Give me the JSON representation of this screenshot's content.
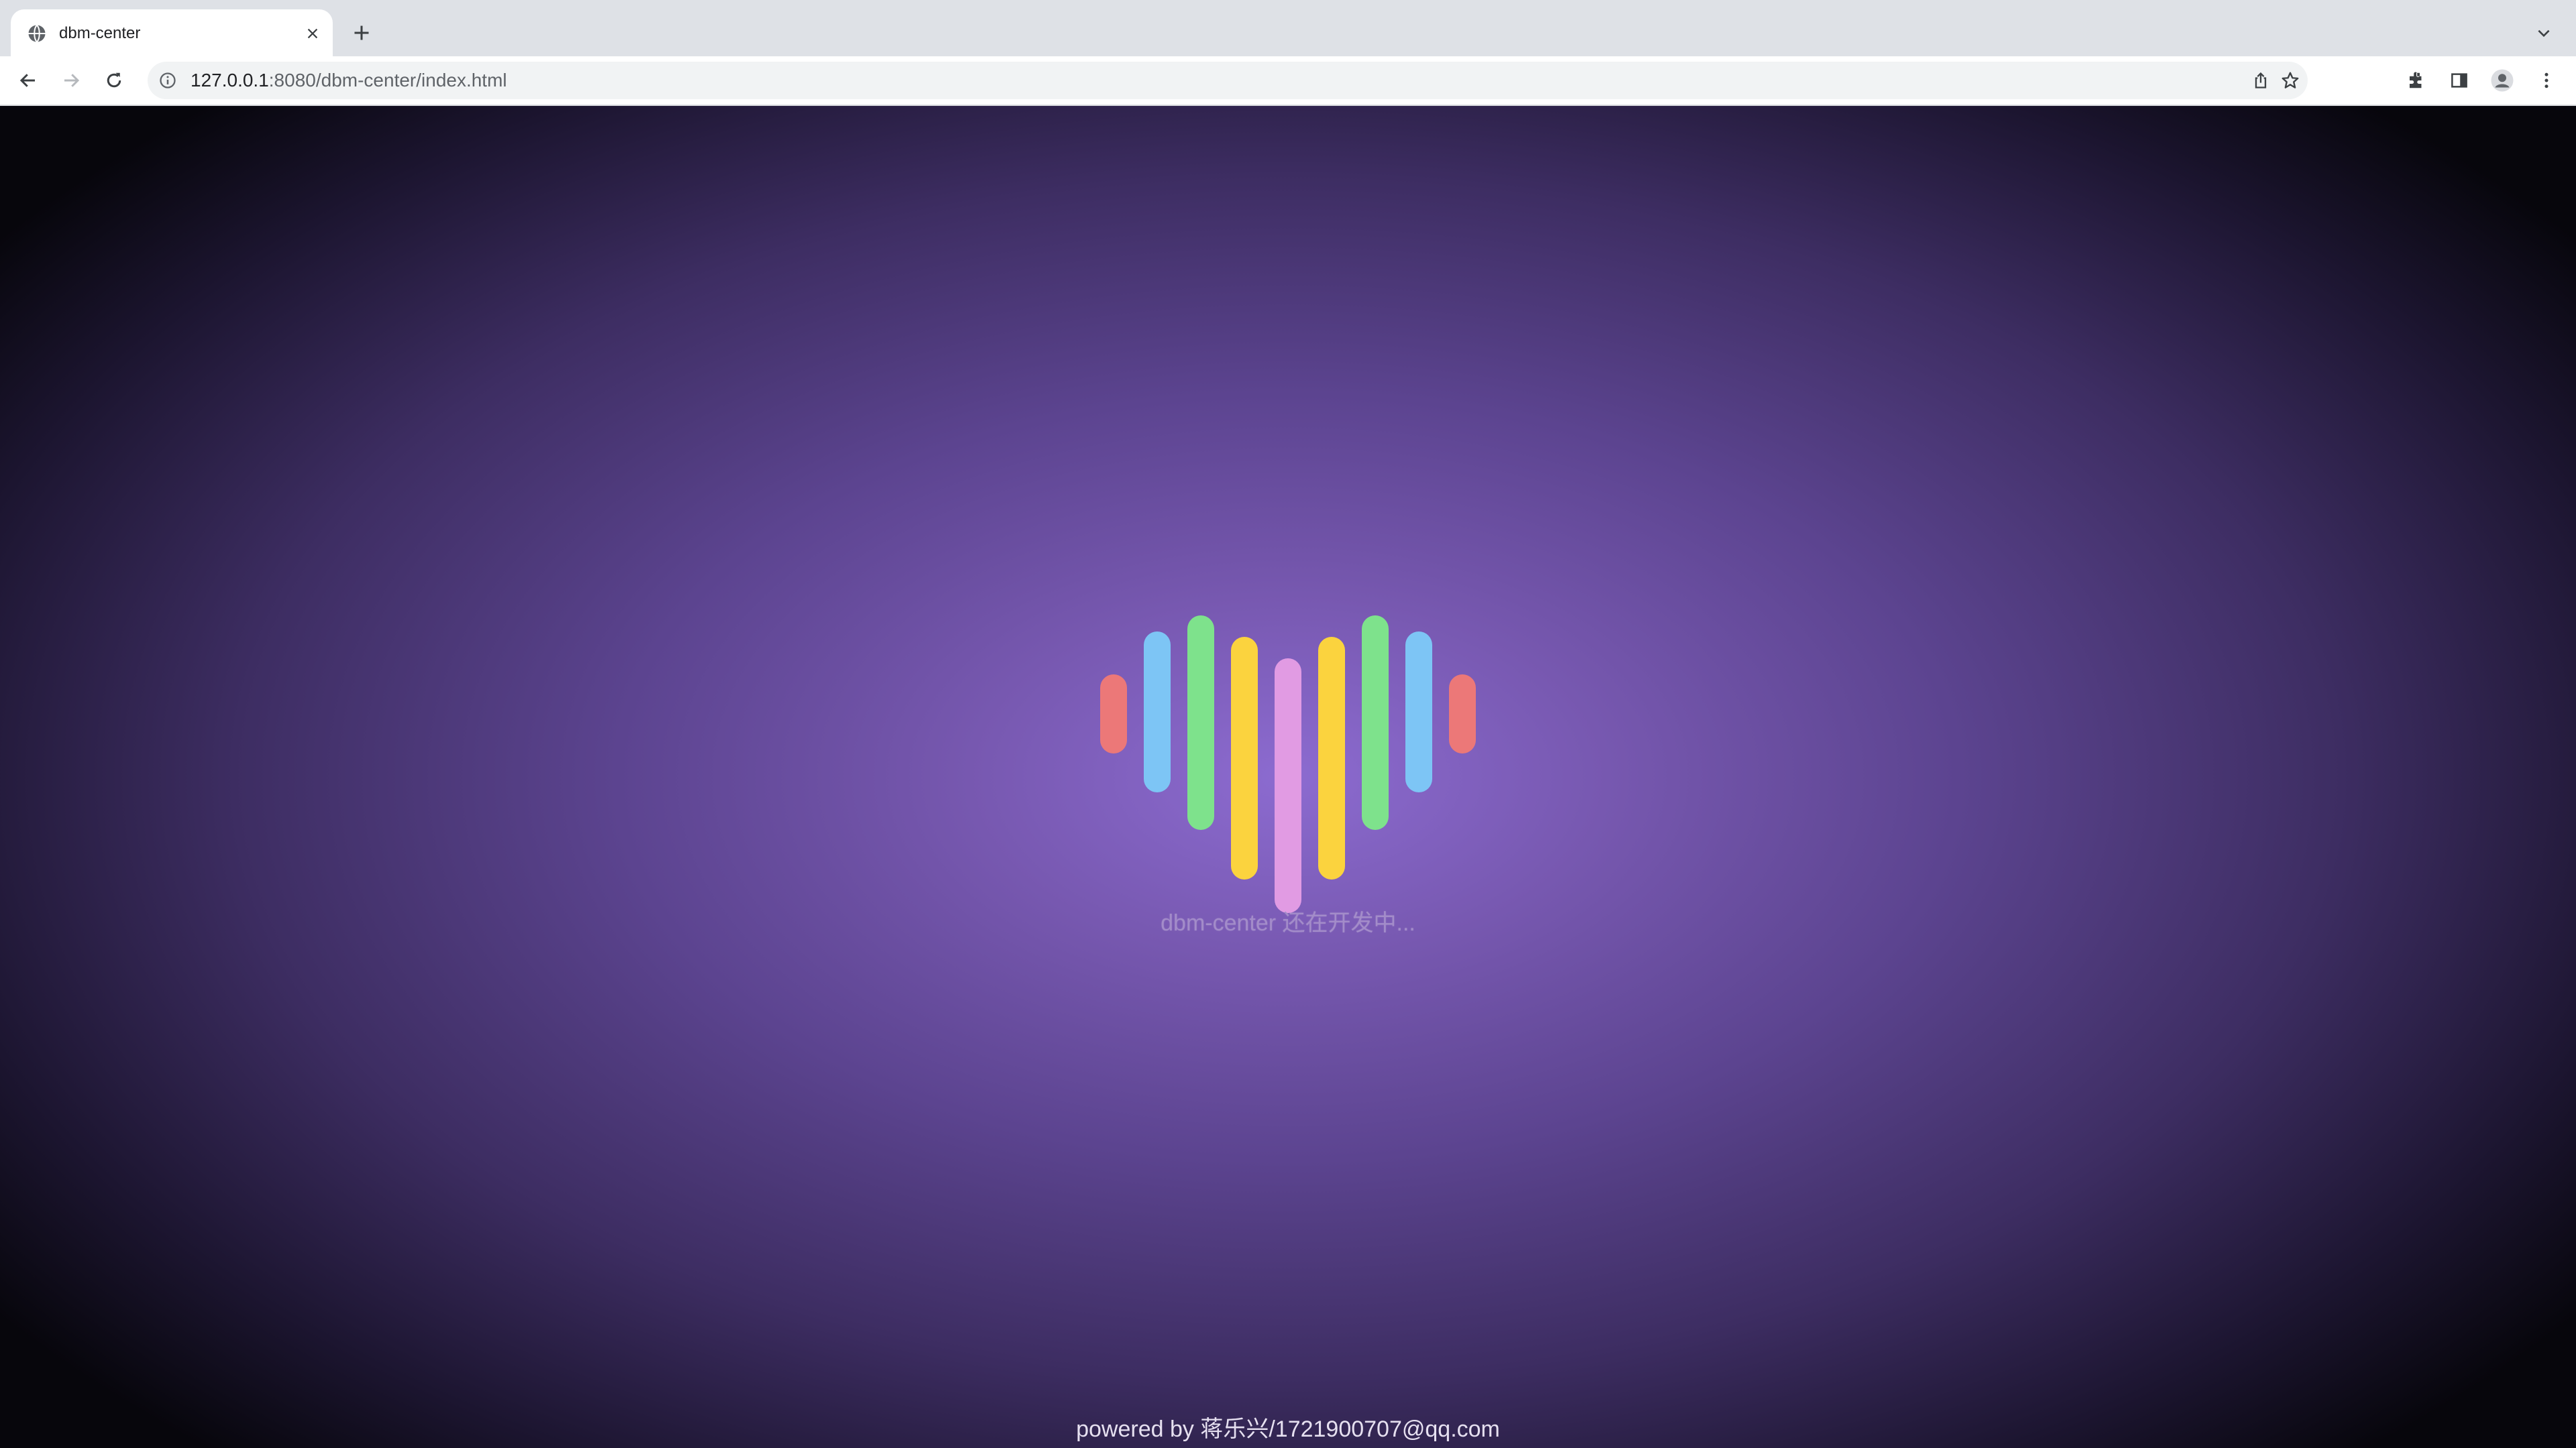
{
  "browser": {
    "tab": {
      "title": "dbm-center",
      "favicon": "globe-icon"
    },
    "address_bar": {
      "host": "127.0.0.1",
      "path": ":8080/dbm-center/index.html"
    },
    "toolbar_icons": [
      "back-icon",
      "forward-icon",
      "reload-icon",
      "info-icon",
      "share-icon",
      "star-icon",
      "extensions-icon",
      "side-panel-icon",
      "profile-icon",
      "menu-icon"
    ]
  },
  "page": {
    "status_text": "dbm-center 还在开发中...",
    "footer_text": "powered by 蒋乐兴/1721900707@qq.com",
    "loader_colors": {
      "red": "#ec7878",
      "blue": "#7dc5f5",
      "green": "#7ee28c",
      "yellow": "#fbd33e",
      "pink": "#e19be3"
    }
  }
}
